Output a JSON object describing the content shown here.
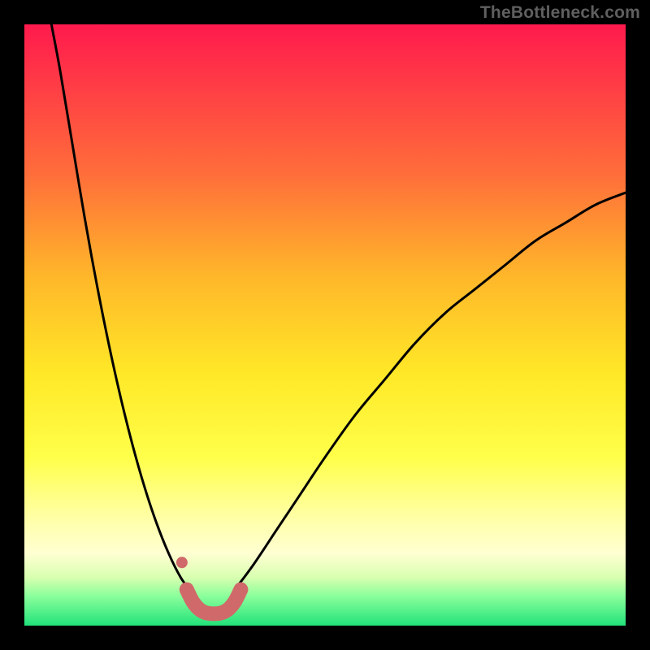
{
  "watermark": "TheBottleneck.com",
  "chart_data": {
    "type": "line",
    "title": "",
    "xlabel": "",
    "ylabel": "",
    "xlim": [
      0,
      100
    ],
    "ylim": [
      0,
      100
    ],
    "grid": false,
    "legend": false,
    "series": [
      {
        "name": "left-curve",
        "color": "#000000",
        "x": [
          4.5,
          6,
          8,
          10,
          12,
          14,
          16,
          18,
          20,
          22,
          24,
          26,
          27.5
        ],
        "y": [
          100,
          92,
          80,
          68,
          57,
          47,
          38,
          30,
          23,
          17,
          12,
          8,
          6
        ]
      },
      {
        "name": "right-curve",
        "color": "#000000",
        "x": [
          35,
          38,
          42,
          46,
          50,
          55,
          60,
          65,
          70,
          75,
          80,
          85,
          90,
          95,
          100
        ],
        "y": [
          6,
          10,
          16,
          22,
          28,
          35,
          41,
          47,
          52,
          56,
          60,
          64,
          67,
          70,
          72
        ]
      },
      {
        "name": "optimal-band",
        "color": "#d06a6a",
        "x": [
          27,
          28,
          29,
          30,
          31,
          32,
          33,
          34,
          35,
          36
        ],
        "y": [
          6,
          4,
          2.8,
          2.2,
          2,
          2,
          2.2,
          2.8,
          4,
          6
        ]
      },
      {
        "name": "optimal-marker-dot",
        "color": "#d06a6a",
        "x": [
          26.2
        ],
        "y": [
          10.5
        ]
      }
    ]
  }
}
